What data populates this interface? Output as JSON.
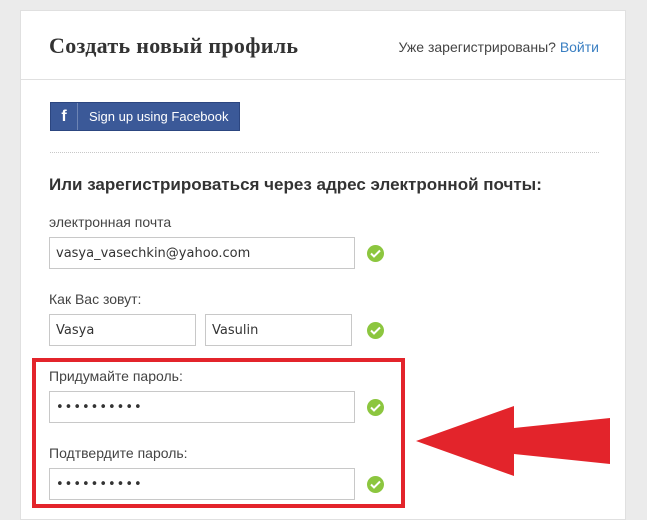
{
  "header": {
    "title": "Создать новый профиль",
    "already_text": "Уже зарегистрированы?",
    "login_link": "Войти"
  },
  "facebook": {
    "icon": "facebook-f-icon",
    "label": "Sign up using Facebook",
    "color": "#3b5998"
  },
  "form": {
    "heading": "Или зарегистрироваться через адрес электронной почты:",
    "email": {
      "label": "электронная почта",
      "value": "vasya_vasechkin@yahoo.com"
    },
    "name": {
      "label": "Как Вас зовут:",
      "first_name": "Vasya",
      "last_name": "Vasulin"
    },
    "password": {
      "label": "Придумайте пароль:",
      "value": "••••••••••"
    },
    "confirm_password": {
      "label": "Подтвердите пароль:",
      "value": "••••••••••"
    },
    "valid_icon": "check-circle-icon",
    "valid_color": "#8cc63f"
  },
  "annotation": {
    "highlight_color": "#e3242b",
    "arrow_icon": "left-arrow-icon"
  }
}
